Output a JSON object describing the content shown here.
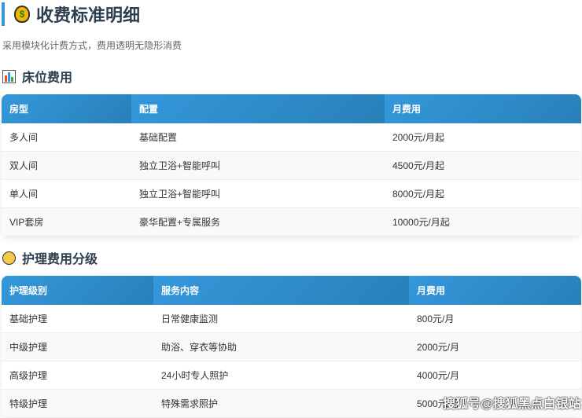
{
  "title": "收费标准明细",
  "subtitle": "采用模块化计费方式，费用透明无隐形消费",
  "bed": {
    "heading": "床位费用",
    "headers": [
      "房型",
      "配置",
      "月费用"
    ],
    "rows": [
      [
        "多人间",
        "基础配置",
        "2000元/月起"
      ],
      [
        "双人间",
        "独立卫浴+智能呼叫",
        "4500元/月起"
      ],
      [
        "单人间",
        "独立卫浴+智能呼叫",
        "8000元/月起"
      ],
      [
        "VIP套房",
        "豪华配置+专属服务",
        "10000元/月起"
      ]
    ]
  },
  "care": {
    "heading": "护理费用分级",
    "headers": [
      "护理级别",
      "服务内容",
      "月费用"
    ],
    "rows": [
      [
        "基础护理",
        "日常健康监测",
        "800元/月"
      ],
      [
        "中级护理",
        "助浴、穿衣等协助",
        "2000元/月"
      ],
      [
        "高级护理",
        "24小时专人照护",
        "4000元/月"
      ],
      [
        "特级护理",
        "特殊需求照护",
        "5000元/月"
      ]
    ]
  },
  "watermark": "搜狐号@搜狐黑点白银站"
}
